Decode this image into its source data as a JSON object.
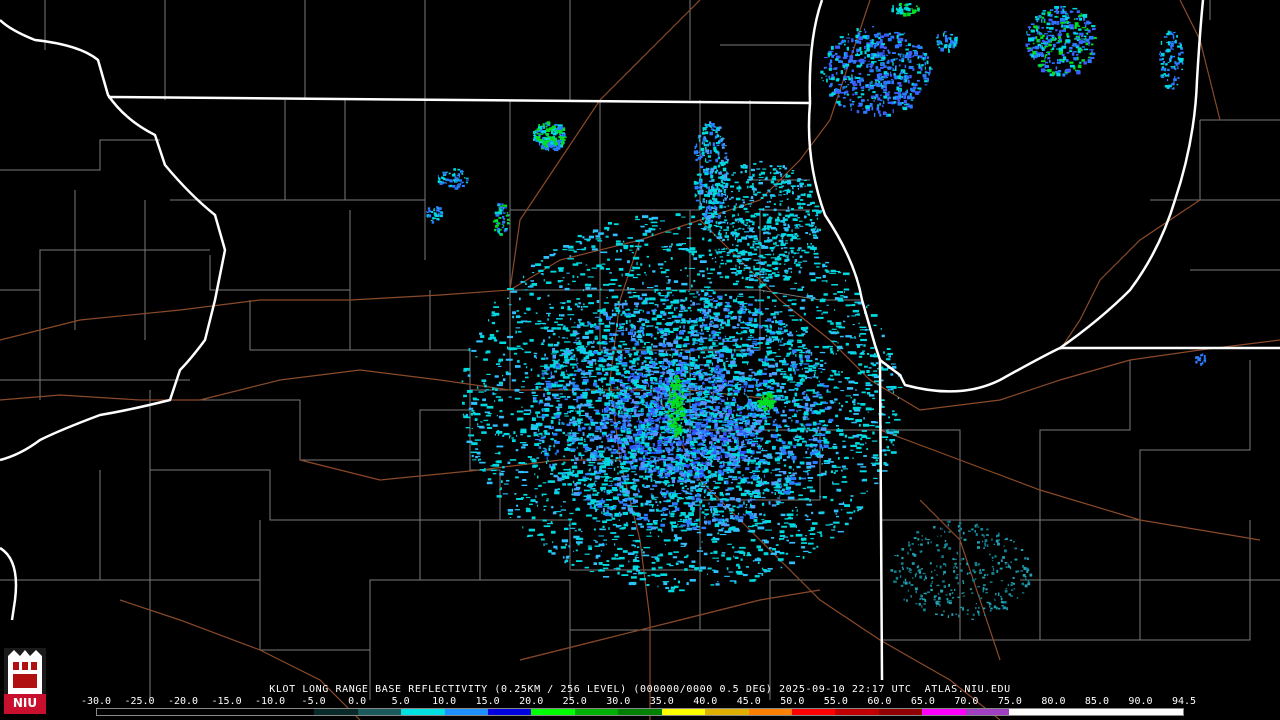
{
  "caption": "KLOT LONG RANGE BASE REFLECTIVITY (0.25KM / 256 LEVEL) (000000/0000 0.5 DEG) 2025-09-10 22:17 UTC  ATLAS.NIU.EDU",
  "logo": {
    "text": "NIU"
  },
  "legend": {
    "ticks": [
      "-30.0",
      "-25.0",
      "-20.0",
      "-15.0",
      "-10.0",
      "-5.0",
      "0.0",
      "5.0",
      "10.0",
      "15.0",
      "20.0",
      "25.0",
      "30.0",
      "35.0",
      "40.0",
      "45.0",
      "50.0",
      "55.0",
      "60.0",
      "65.0",
      "70.0",
      "75.0",
      "80.0",
      "85.0",
      "90.0",
      "94.5"
    ],
    "colors": [
      "#000000",
      "#000000",
      "#000000",
      "#000000",
      "#000000",
      "#0a2a2a",
      "#1a5a5a",
      "#00e0e0",
      "#1e90ff",
      "#0000e0",
      "#00ff00",
      "#00b000",
      "#008000",
      "#ffff00",
      "#e0b000",
      "#ff8000",
      "#ff0000",
      "#c00000",
      "#900000",
      "#ff00ff",
      "#a040c0",
      "#ffffff",
      "#ffffff",
      "#ffffff",
      "#ffffff"
    ]
  },
  "colors": {
    "state_border": "#ffffff",
    "county_line": "#808080",
    "highway": "#8b4a2a",
    "echo_cyan": "#00d8e0",
    "echo_blue": "#2a7bff",
    "echo_green": "#00e020",
    "radar_site": "#000000"
  }
}
